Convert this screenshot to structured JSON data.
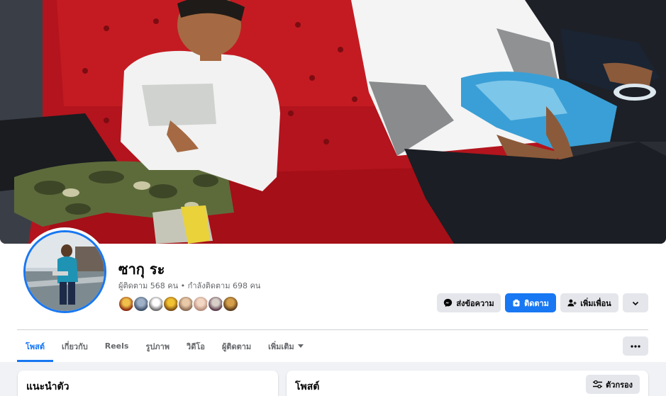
{
  "profile": {
    "name": "ซากุ ระ",
    "followers_text": "ผู้ติดตาม 568 คน",
    "following_text": "กำลังติดตาม 698 คน",
    "separator": " • "
  },
  "actions": {
    "message_label": "ส่งข้อความ",
    "follow_label": "ติดตาม",
    "add_friend_label": "เพิ่มเพื่อน"
  },
  "tabs": [
    {
      "label": "โพสต์",
      "active": true
    },
    {
      "label": "เกี่ยวกับ",
      "active": false
    },
    {
      "label": "Reels",
      "active": false
    },
    {
      "label": "รูปภาพ",
      "active": false
    },
    {
      "label": "วิดีโอ",
      "active": false
    },
    {
      "label": "ผู้ติดตาม",
      "active": false
    },
    {
      "label": "เพิ่มเติม",
      "active": false
    }
  ],
  "intro_card": {
    "title": "แนะนำตัว"
  },
  "posts_card": {
    "title": "โพสต์",
    "filter_label": "ตัวกรอง"
  },
  "follower_avatar_icons": [
    "avatar-1",
    "avatar-2",
    "avatar-3",
    "avatar-4",
    "avatar-5",
    "avatar-6",
    "avatar-7",
    "avatar-8"
  ],
  "colors": {
    "accent": "#1877f2",
    "page_bg": "#f0f2f5",
    "button_grey": "#e4e6eb",
    "secondary_text": "#65676b"
  }
}
